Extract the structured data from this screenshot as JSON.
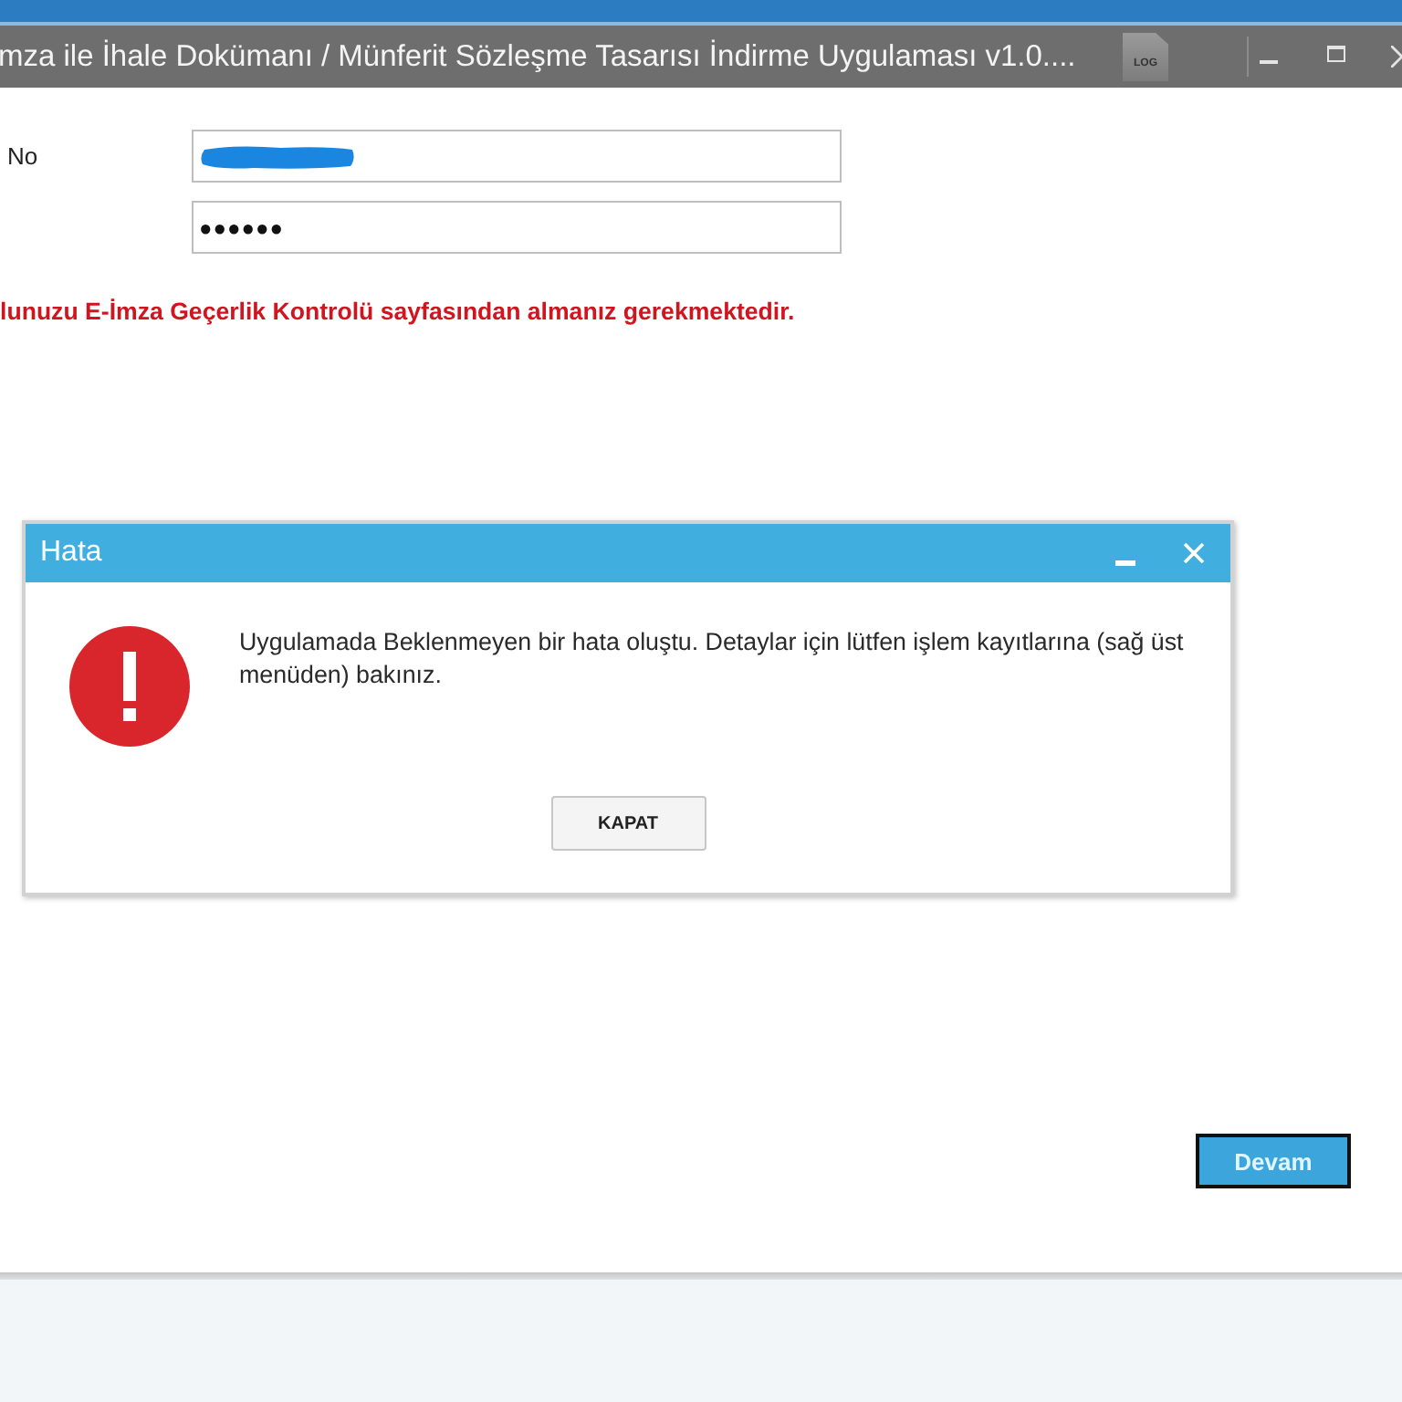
{
  "window": {
    "title": "mza ile İhale Dokümanı / Münferit Sözleşme Tasarısı İndirme Uygulaması v1.0....",
    "log_button": "LOG"
  },
  "form": {
    "fields": [
      {
        "label": "No",
        "redacted": true
      },
      {
        "value": "●●●●●●",
        "redacted": false
      }
    ],
    "notice": "lunuzu E-İmza Geçerlik Kontrolü sayfasından almanız gerekmektedir."
  },
  "dialog": {
    "title": "Hata",
    "kind": "error",
    "message": "Uygulamada Beklenmeyen bir hata oluştu. Detaylar için lütfen işlem kayıtlarına (sağ üst menüden) bakınız.",
    "buttons": [
      {
        "label": "KAPAT"
      }
    ]
  },
  "continue_button": {
    "label": "Devam",
    "focused": true
  }
}
